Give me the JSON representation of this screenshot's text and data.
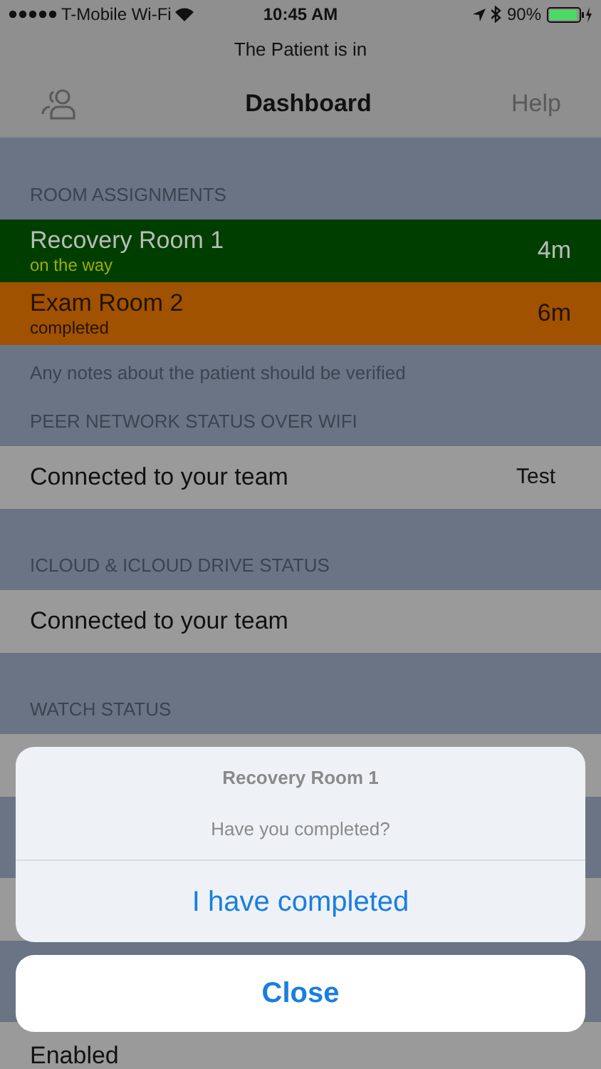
{
  "status_bar": {
    "carrier": "T-Mobile Wi-Fi",
    "time": "10:45 AM",
    "battery": "90%"
  },
  "banner": "The Patient is in",
  "nav": {
    "title": "Dashboard",
    "right": "Help"
  },
  "sections": [
    {
      "header": "ROOM ASSIGNMENTS",
      "rows": [
        {
          "kind": "room",
          "title": "Recovery Room 1",
          "subtitle": "on the way",
          "value": "4m",
          "color": "#003e00"
        },
        {
          "kind": "room",
          "title": "Exam Room 2",
          "subtitle": "completed",
          "value": "6m",
          "color": "#a05200"
        }
      ],
      "footer": "Any notes about the patient should be verified"
    },
    {
      "header": "PEER NETWORK STATUS OVER WIFI",
      "rows": [
        {
          "kind": "status",
          "title": "Connected to your team",
          "value": "Test"
        }
      ]
    },
    {
      "header": "ICLOUD & ICLOUD DRIVE STATUS",
      "rows": [
        {
          "kind": "status",
          "title": "Connected to your team"
        }
      ]
    },
    {
      "header": "WATCH STATUS",
      "rows": [
        {
          "kind": "blank"
        }
      ]
    },
    {
      "rows": [
        {
          "kind": "blank"
        }
      ]
    },
    {
      "rows": [
        {
          "kind": "status",
          "title": "Enabled"
        }
      ]
    }
  ],
  "sheet": {
    "title": "Recovery Room 1",
    "message": "Have you completed?",
    "action": "I have completed",
    "cancel": "Close"
  }
}
